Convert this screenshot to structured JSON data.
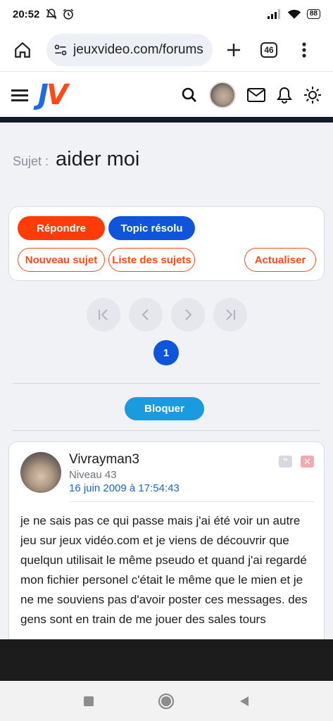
{
  "status": {
    "time": "20:52",
    "battery": "88"
  },
  "browser": {
    "url": "jeuxvideo.com/forums",
    "tab_count": "46"
  },
  "site": {
    "logo_j": "J",
    "logo_v": "V"
  },
  "topic": {
    "label": "Sujet :",
    "title": "aider moi"
  },
  "actions": {
    "repondre": "Répondre",
    "resolu": "Topic résolu",
    "nouveau": "Nouveau sujet",
    "liste": "Liste des sujets",
    "actualiser": "Actualiser"
  },
  "pagination": {
    "current": "1"
  },
  "bloquer": "Bloquer",
  "post": {
    "author": "Vivrayman3",
    "level": "Niveau 43",
    "date": "16 juin 2009 à 17:54:43",
    "quote_symbol": "”",
    "delete_symbol": "✕",
    "text": "je ne sais pas ce qui passe mais j'ai été voir un autre jeu sur jeux vidéo.com et je viens de découvrir que quelqun utilisait le même pseudo et quand j'ai regardé mon fichier personel c'était le même que le mien et je ne me souviens pas d'avoir poster ces messages. des gens sont en train de me jouer des sales tours"
  },
  "colors": {
    "orange": "#ff3b0a",
    "blue": "#0f55dc",
    "bloquer": "#1a9be0"
  }
}
